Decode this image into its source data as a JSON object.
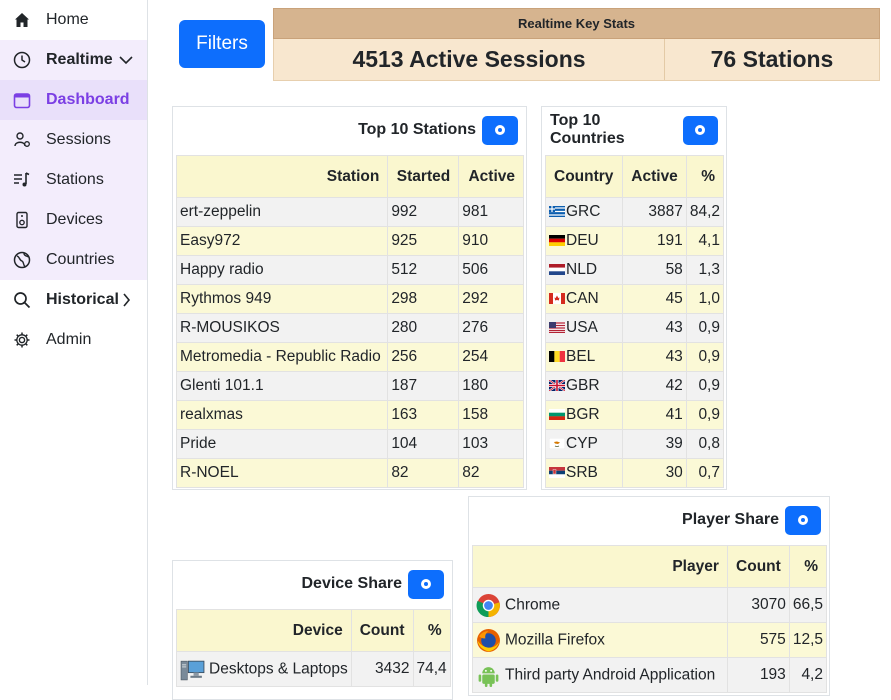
{
  "sidebar": {
    "items": [
      {
        "label": "Home",
        "icon": "home-icon"
      },
      {
        "label": "Realtime",
        "icon": "clock-icon"
      },
      {
        "label": "Dashboard",
        "icon": "calendar-icon"
      },
      {
        "label": "Sessions",
        "icon": "users-icon"
      },
      {
        "label": "Stations",
        "icon": "music-list-icon"
      },
      {
        "label": "Devices",
        "icon": "device-icon"
      },
      {
        "label": "Countries",
        "icon": "globe-icon"
      },
      {
        "label": "Historical",
        "icon": "search-icon"
      },
      {
        "label": "Admin",
        "icon": "gear-icon"
      }
    ]
  },
  "filters_label": "Filters",
  "keystats": {
    "title": "Realtime Key Stats",
    "sessions": "4513 Active Sessions",
    "stations": "76 Stations"
  },
  "top_stations": {
    "title": "Top 10 Stations",
    "headers": [
      "Station",
      "Started",
      "Active"
    ],
    "rows": [
      [
        "ert-zeppelin",
        "992",
        "981"
      ],
      [
        "Easy972",
        "925",
        "910"
      ],
      [
        "Happy radio",
        "512",
        "506"
      ],
      [
        "Rythmos 949",
        "298",
        "292"
      ],
      [
        "R-MOUSIKOS",
        "280",
        "276"
      ],
      [
        "Metromedia - Republic Radio",
        "256",
        "254"
      ],
      [
        "Glenti 101.1",
        "187",
        "180"
      ],
      [
        "realxmas",
        "163",
        "158"
      ],
      [
        "Pride",
        "104",
        "103"
      ],
      [
        "R-NOEL",
        "82",
        "82"
      ]
    ]
  },
  "top_countries": {
    "title": "Top 10 Countries",
    "headers": [
      "Country",
      "Active",
      "%"
    ],
    "rows": [
      [
        "GRC",
        "3887",
        "84,2"
      ],
      [
        "DEU",
        "191",
        "4,1"
      ],
      [
        "NLD",
        "58",
        "1,3"
      ],
      [
        "CAN",
        "45",
        "1,0"
      ],
      [
        "USA",
        "43",
        "0,9"
      ],
      [
        "BEL",
        "43",
        "0,9"
      ],
      [
        "GBR",
        "42",
        "0,9"
      ],
      [
        "BGR",
        "41",
        "0,9"
      ],
      [
        "CYP",
        "39",
        "0,8"
      ],
      [
        "SRB",
        "30",
        "0,7"
      ]
    ]
  },
  "player_share": {
    "title": "Player Share",
    "headers": [
      "Player",
      "Count",
      "%"
    ],
    "rows": [
      [
        "Chrome",
        "3070",
        "66,5"
      ],
      [
        "Mozilla Firefox",
        "575",
        "12,5"
      ],
      [
        "Third party Android Application",
        "193",
        "4,2"
      ]
    ]
  },
  "device_share": {
    "title": "Device Share",
    "headers": [
      "Device",
      "Count",
      "%"
    ],
    "rows": [
      [
        "Desktops & Laptops",
        "3432",
        "74,4"
      ]
    ]
  },
  "colors": {
    "accent": "#0d6efd",
    "active_nav": "#7b3fe4",
    "keystats_head": "#d6b48f",
    "keystats_body": "#f8e7cf",
    "table_header": "#faf7cf"
  }
}
